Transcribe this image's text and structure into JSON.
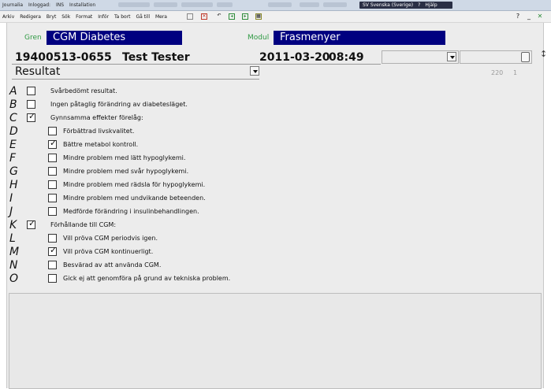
{
  "titlebar": {
    "segments": [
      "Journalia",
      "Inloggad:",
      "INS",
      "Installation"
    ],
    "language": "SV Svenska (Sverige)",
    "help": "Hjälp"
  },
  "menu": [
    "Arkiv",
    "Redigera",
    "Bryt",
    "Sök",
    "Format",
    "Inför",
    "Ta bort",
    "Gå till",
    "Mera"
  ],
  "header": {
    "gren_label": "Gren",
    "gren_value": "CGM Diabetes",
    "modul_label": "Modul",
    "modul_value": "Frasmenyer"
  },
  "patient": {
    "id": "19400513-0655",
    "name": "Test Tester",
    "date": "2011-03-20",
    "time": "08:49"
  },
  "section": {
    "title": "Resultat",
    "num_a": "220",
    "num_b": "1"
  },
  "items": [
    {
      "letter": "A",
      "label": "Svårbedömt resultat.",
      "checked": false,
      "indent": 0
    },
    {
      "letter": "B",
      "label": "Ingen påtaglig förändring av diabetesläget.",
      "checked": false,
      "indent": 0
    },
    {
      "letter": "C",
      "label": "Gynnsamma effekter förelåg:",
      "checked": true,
      "indent": 0
    },
    {
      "letter": "D",
      "label": "Förbättrad livskvalitet.",
      "checked": false,
      "indent": 1
    },
    {
      "letter": "E",
      "label": "Bättre metabol kontroll.",
      "checked": true,
      "indent": 1
    },
    {
      "letter": "F",
      "label": "Mindre problem med lätt hypoglykemi.",
      "checked": false,
      "indent": 1
    },
    {
      "letter": "G",
      "label": "Mindre problem med svår hypoglykemi.",
      "checked": false,
      "indent": 1
    },
    {
      "letter": "H",
      "label": "Mindre problem med rädsla för hypoglykemi.",
      "checked": false,
      "indent": 1
    },
    {
      "letter": "I",
      "label": "Mindre problem med undvikande beteenden.",
      "checked": false,
      "indent": 1
    },
    {
      "letter": "J",
      "label": "Medförde förändring i insulinbehandlingen.",
      "checked": false,
      "indent": 1
    },
    {
      "letter": "K",
      "label": "Förhållande till CGM:",
      "checked": true,
      "indent": 0
    },
    {
      "letter": "L",
      "label": "Vill pröva CGM periodvis igen.",
      "checked": false,
      "indent": 1
    },
    {
      "letter": "M",
      "label": "Vill pröva CGM kontinuerligt.",
      "checked": true,
      "indent": 1
    },
    {
      "letter": "N",
      "label": "Besvärad av att använda CGM.",
      "checked": false,
      "indent": 1
    },
    {
      "letter": "O",
      "label": "Gick ej att genomföra på grund av tekniska problem.",
      "checked": false,
      "indent": 1
    }
  ],
  "colors": {
    "accent_navy": "#000080",
    "label_green": "#2f9a43",
    "background": "#ececec"
  }
}
